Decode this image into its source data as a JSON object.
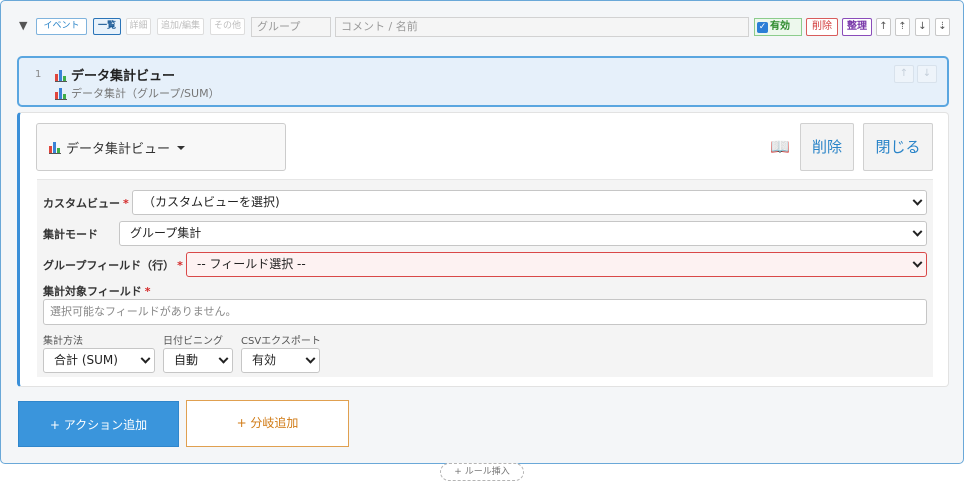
{
  "header": {
    "collapse_glyph": "▼",
    "tags": [
      "イベント",
      "一覧",
      "詳細",
      "追加/編集",
      "その他"
    ],
    "group_placeholder": "グループ",
    "comment_placeholder": "コメント / 名前",
    "enabled_label": "有効",
    "enabled_checked": true,
    "delete_label": "削除",
    "organize_label": "整理",
    "arrows": [
      "↑",
      "⇡",
      "↓",
      "⇣"
    ]
  },
  "item": {
    "number": "1",
    "title": "データ集計ビュー",
    "subtitle": "データ集計（グループ/SUM）",
    "move_up": "↑",
    "move_down": "↓"
  },
  "editor": {
    "type_label": "データ集計ビュー",
    "book_icon": "📖",
    "delete_label": "削除",
    "close_label": "閉じる",
    "fields": {
      "custom_view": {
        "label": "カスタムビュー",
        "required": "*",
        "value": "（カスタムビューを選択)"
      },
      "mode": {
        "label": "集計モード",
        "value": "グループ集計"
      },
      "group_field": {
        "label": "グループフィールド（行）",
        "required": "*",
        "value": "-- フィールド選択 --"
      },
      "target_field": {
        "label": "集計対象フィールド",
        "required": "*",
        "placeholder": "選択可能なフィールドがありません。"
      },
      "method": {
        "label": "集計方法",
        "value": "合計 (SUM)"
      },
      "date_bin": {
        "label": "日付ビニング",
        "value": "自動"
      },
      "csv_export": {
        "label": "CSVエクスポート",
        "value": "有効"
      }
    }
  },
  "bottom": {
    "add_action": "+ アクション追加",
    "add_branch": "+ 分岐追加",
    "insert_rule": "+ ルール挿入"
  }
}
